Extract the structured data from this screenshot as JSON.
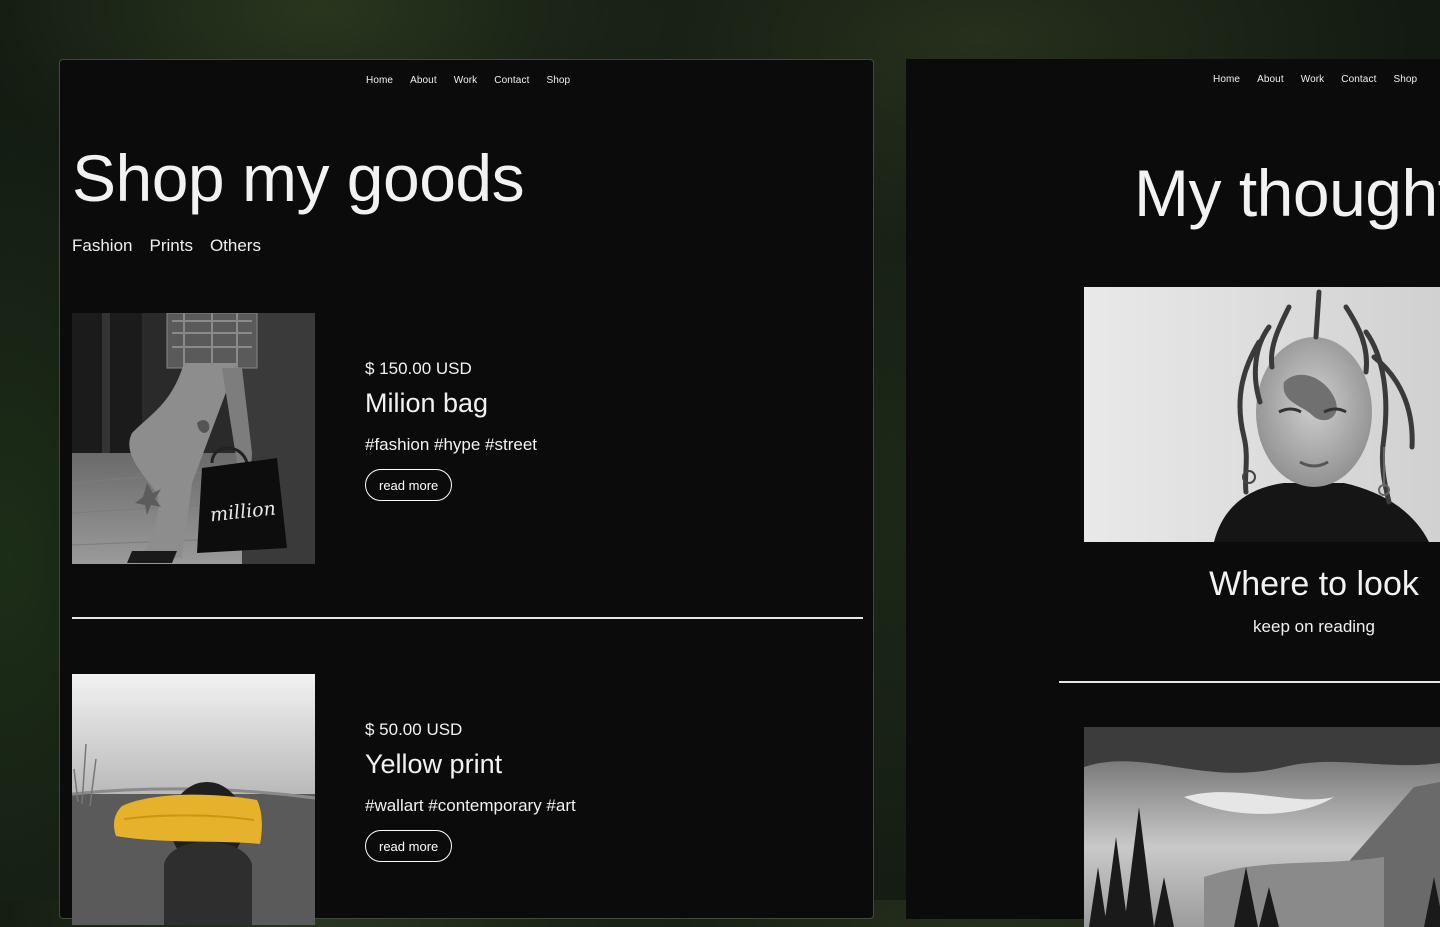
{
  "nav": {
    "home": "Home",
    "about": "About",
    "work": "Work",
    "contact": "Contact",
    "shop": "Shop"
  },
  "shop_page": {
    "title": "Shop my goods",
    "categories": [
      "Fashion",
      "Prints",
      "Others"
    ],
    "products": [
      {
        "price": "$ 150.00 USD",
        "name": "Milion bag",
        "tags": "#fashion #hype #street",
        "button": "read more",
        "image_text": "million"
      },
      {
        "price": "$ 50.00 USD",
        "name": "Yellow print",
        "tags": "#wallart #contemporary #art",
        "button": "read more"
      }
    ]
  },
  "blog_page": {
    "title": "My thoughts",
    "posts": [
      {
        "title": "Where to look",
        "link": "keep on reading"
      }
    ]
  },
  "colors": {
    "window_bg": "#0b0b0b",
    "text": "#f2f2f2",
    "accent_yellow": "#e6b22b",
    "backdrop_green": "#131a12"
  }
}
